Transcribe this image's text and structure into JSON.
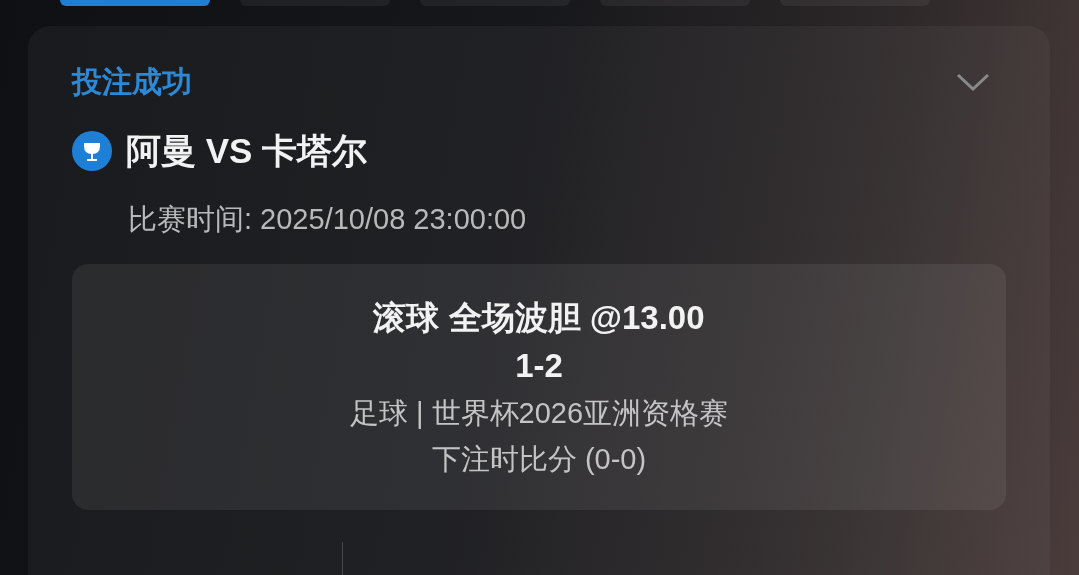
{
  "tabs": [
    {
      "selected": true
    },
    {
      "selected": false
    },
    {
      "selected": false
    },
    {
      "selected": false
    },
    {
      "selected": false
    }
  ],
  "bet_card": {
    "status": "投注成功",
    "expanded": true,
    "match": "阿曼 VS 卡塔尔",
    "match_time": "比赛时间: 2025/10/08 23:00:00",
    "selection": {
      "market": "滚球 全场波胆 @13.00",
      "pick": "1-2",
      "competition": "足球 | 世界杯2026亚洲资格赛",
      "score_at_bet": "下注时比分 (0-0)"
    }
  }
}
